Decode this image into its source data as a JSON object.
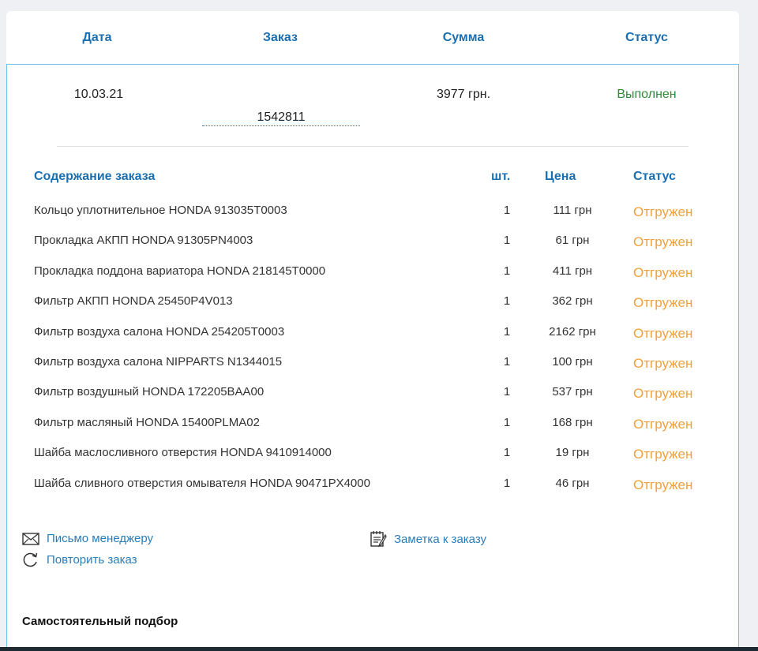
{
  "header": {
    "date": "Дата",
    "order": "Заказ",
    "sum": "Сумма",
    "status": "Статус"
  },
  "order": {
    "date": "10.03.21",
    "number": "1542811",
    "sum": "3977 грн.",
    "status": "Выполнен"
  },
  "items_section": {
    "title": "Содержание заказа",
    "qty_header": "шт.",
    "price_header": "Цена",
    "status_header": "Статус"
  },
  "items": [
    {
      "name": "Кольцо уплотнительное HONDA 913035T0003",
      "qty": "1",
      "price": "111 грн",
      "status": "Отгружен"
    },
    {
      "name": "Прокладка АКПП HONDA 91305PN4003",
      "qty": "1",
      "price": "61 грн",
      "status": "Отгружен"
    },
    {
      "name": "Прокладка поддона вариатора HONDA 218145T0000",
      "qty": "1",
      "price": "411 грн",
      "status": "Отгружен"
    },
    {
      "name": "Фильтр АКПП HONDA 25450P4V013",
      "qty": "1",
      "price": "362 грн",
      "status": "Отгружен"
    },
    {
      "name": "Фильтр воздуха салона HONDA 254205T0003",
      "qty": "1",
      "price": "2162 грн",
      "status": "Отгружен"
    },
    {
      "name": "Фильтр воздуха салона NIPPARTS N1344015",
      "qty": "1",
      "price": "100 грн",
      "status": "Отгружен"
    },
    {
      "name": "Фильтр воздушный HONDA 172205BAA00",
      "qty": "1",
      "price": "537 грн",
      "status": "Отгружен"
    },
    {
      "name": "Фильтр масляный HONDA 15400PLMA02",
      "qty": "1",
      "price": "168 грн",
      "status": "Отгружен"
    },
    {
      "name": "Шайба маслосливного отверстия HONDA 9410914000",
      "qty": "1",
      "price": "19 грн",
      "status": "Отгружен"
    },
    {
      "name": "Шайба сливного отверстия омывателя HONDA 90471PX4000",
      "qty": "1",
      "price": "46 грн",
      "status": "Отгружен"
    }
  ],
  "actions": {
    "mail_manager": "Письмо менеджеру",
    "repeat_order": "Повторить заказ",
    "order_note": "Заметка к заказу"
  },
  "icons": {
    "mail": "mail-icon",
    "repeat": "repeat-icon",
    "note": "note-icon"
  },
  "footer": {
    "title": "Самостоятельный подбор"
  },
  "colors": {
    "header_blue": "#1a6fb0",
    "link_blue": "#2a7cb8",
    "done_green": "#2e8b3c",
    "shipped_orange": "#f0a03a",
    "panel_border": "#6cc4e8"
  }
}
